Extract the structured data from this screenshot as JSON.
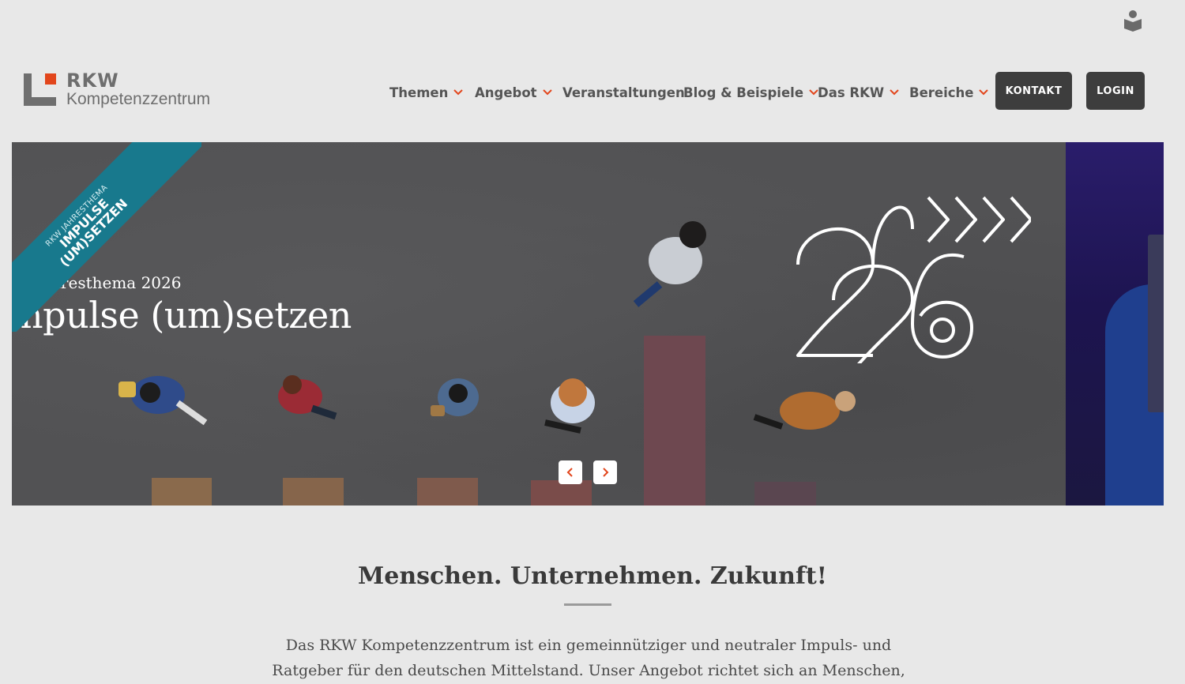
{
  "topbar": {
    "accessibility_icon": "accessibility-reader-icon"
  },
  "logo": {
    "brand": "RKW",
    "subtitle": "Kompetenzzentrum",
    "accent_color": "#e2461c"
  },
  "nav": {
    "items": [
      {
        "label": "Themen",
        "has_dropdown": true
      },
      {
        "label": "Angebot",
        "has_dropdown": true
      },
      {
        "label": "Veranstaltungen",
        "has_dropdown": false
      },
      {
        "label": "Blog & Beispiele",
        "has_dropdown": true
      },
      {
        "label": "Das RKW",
        "has_dropdown": true
      },
      {
        "label": "Bereiche",
        "has_dropdown": true
      }
    ],
    "chevron_color": "#e2461c",
    "contact_label": "KONTAKT",
    "login_label": "LOGIN"
  },
  "hero": {
    "ribbon_line1": "RKW JAHRESTHEMA",
    "ribbon_line2": "IMPULSE",
    "ribbon_line3": "(UM)SETZEN",
    "ribbon_color": "#18798d",
    "kicker": "/ Jahresthema 2026",
    "title": "mpulse (um)setzen",
    "prev_icon": "chevron-left-icon",
    "next_icon": "chevron-right-icon"
  },
  "intro": {
    "heading": "Menschen. Unternehmen. Zukunft!",
    "paragraph": "Das RKW Kompetenzzentrum ist ein gemeinnütziger und neutraler Impuls- und Ratgeber für den deutschen Mittelstand. Unser Angebot richtet sich an Menschen, die ihr etabliertes"
  }
}
